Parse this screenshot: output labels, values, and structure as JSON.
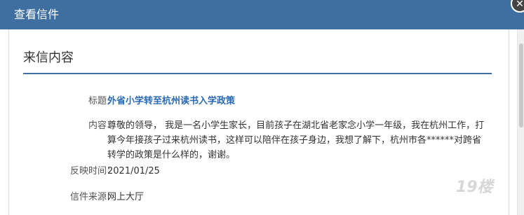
{
  "dialog": {
    "title": "查看信件",
    "close_icon": "close-icon"
  },
  "section": {
    "title": "来信内容"
  },
  "fields": {
    "subject_label": "标题：",
    "subject_value": "外省小学转至杭州读书入学政策",
    "content_label": "内容：",
    "content_value": "尊敬的领导， 我是一名小学生家长，目前孩子在湖北省老家念小学一年级，我在杭州工作，打算今年接孩子过来杭州读书，这样可以陪伴在孩子身边，我想了解下，杭州市各******对跨省转学的政策是什么样的，谢谢。",
    "time_label": "反映时间：",
    "time_value": "2021/01/25",
    "source_label": "信件来源：",
    "source_value": "网上大厅"
  },
  "watermark": {
    "text": "19楼"
  },
  "colors": {
    "title_bar": "#3f6fa0",
    "subject_link": "#2a6ab5",
    "divider": "#3f6fa0"
  }
}
